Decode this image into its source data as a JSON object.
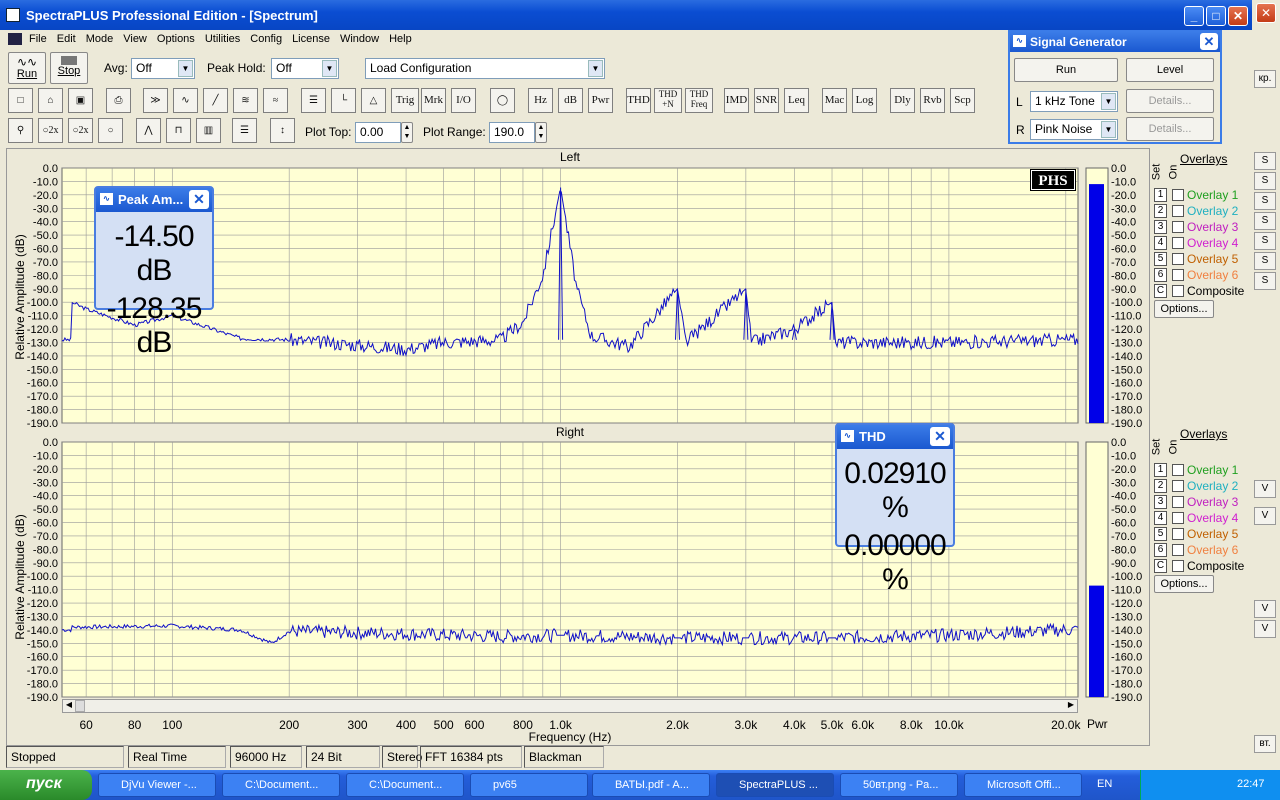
{
  "window": {
    "title": "SpectraPLUS Professional Edition - [Spectrum]"
  },
  "menu": [
    "File",
    "Edit",
    "Mode",
    "View",
    "Options",
    "Utilities",
    "Config",
    "License",
    "Window",
    "Help"
  ],
  "toolbar1": {
    "run": "Run",
    "stop": "Stop",
    "avg_label": "Avg:",
    "avg_value": "Off",
    "peakhold_label": "Peak Hold:",
    "peakhold_value": "Off",
    "config_value": "Load Configuration"
  },
  "toolbar2": [
    "Trig",
    "Mrk",
    "I/O",
    "Hz",
    "dB",
    "Pwr",
    "THD",
    "THD +N",
    "THD Freq",
    "IMD",
    "SNR",
    "Leq",
    "Mac",
    "Log",
    "Dly",
    "Rvb",
    "Scp"
  ],
  "toolbar3": {
    "plot_top_label": "Plot Top:",
    "plot_top_value": "0.00",
    "plot_range_label": "Plot Range:",
    "plot_range_value": "190.0"
  },
  "signal_generator": {
    "title": "Signal Generator",
    "run": "Run",
    "level": "Level",
    "l_label": "L",
    "l_value": "1 kHz Tone",
    "r_label": "R",
    "r_value": "Pink Noise",
    "details1": "Details...",
    "details2": "Details..."
  },
  "plots": {
    "left_title": "Left",
    "right_title": "Right",
    "ylabel": "Relative Amplitude (dB)",
    "xlabel": "Frequency (Hz)",
    "badge": "PHS",
    "pwr": "Pwr",
    "yticks": [
      "0.0",
      "-10.0",
      "-20.0",
      "-30.0",
      "-40.0",
      "-50.0",
      "-60.0",
      "-70.0",
      "-80.0",
      "-90.0",
      "-100.0",
      "-110.0",
      "-120.0",
      "-130.0",
      "-140.0",
      "-150.0",
      "-160.0",
      "-170.0",
      "-180.0",
      "-190.0"
    ],
    "xticks": [
      "60",
      "80",
      "100",
      "200",
      "300",
      "400",
      "500",
      "600",
      "800",
      "1.0k",
      "2.0k",
      "3.0k",
      "4.0k",
      "5.0k",
      "6.0k",
      "8.0k",
      "10.0k",
      "20.0k"
    ]
  },
  "overlays": {
    "header": "Overlays",
    "set": "Set",
    "on": "On",
    "items": [
      {
        "n": "1",
        "label": "Overlay 1",
        "color": "#1f9f1f"
      },
      {
        "n": "2",
        "label": "Overlay 2",
        "color": "#1fb0c0"
      },
      {
        "n": "3",
        "label": "Overlay 3",
        "color": "#c020c0"
      },
      {
        "n": "4",
        "label": "Overlay 4",
        "color": "#d020d0"
      },
      {
        "n": "5",
        "label": "Overlay 5",
        "color": "#c06000"
      },
      {
        "n": "6",
        "label": "Overlay 6",
        "color": "#f08040"
      },
      {
        "n": "C",
        "label": "Composite",
        "color": "#000000"
      }
    ],
    "options": "Options..."
  },
  "peak_popup": {
    "title": "Peak Am...",
    "v1": "-14.50 dB",
    "v2": "-128.35 dB"
  },
  "thd_popup": {
    "title": "THD",
    "v1": "0.02910 %",
    "v2": "0.00000 %"
  },
  "status": [
    "Stopped",
    "Real Time",
    "96000 Hz",
    "24 Bit",
    "Stereo",
    "FFT 16384 pts",
    "Blackman"
  ],
  "taskbar": {
    "start": "пуск",
    "items": [
      "DjVu Viewer -...",
      "C:\\Document...",
      "C:\\Document...",
      "pv65",
      "ВАТЫ.pdf - A...",
      "SpectraPLUS ...",
      "50вт.png - Pa...",
      "Microsoft Offi..."
    ],
    "lang": "EN",
    "clock": "22:47"
  },
  "meters": {
    "left_level_db": -2,
    "right_level_db": -109
  },
  "chart_data": [
    {
      "type": "line",
      "title": "Left",
      "xlabel": "Frequency (Hz)",
      "ylabel": "Relative Amplitude (dB)",
      "ylim": [
        -190,
        0
      ],
      "xscale": "log",
      "series": [
        {
          "values": [
            [
              55,
              -100
            ],
            [
              60,
              -105
            ],
            [
              80,
              -117
            ],
            [
              100,
              -110
            ],
            [
              150,
              -127
            ],
            [
              200,
              -128
            ],
            [
              300,
              -132
            ],
            [
              400,
              -135
            ],
            [
              500,
              -130
            ],
            [
              700,
              -128
            ],
            [
              800,
              -115
            ],
            [
              900,
              -80
            ],
            [
              1000,
              -14.5
            ],
            [
              1100,
              -90
            ],
            [
              1200,
              -125
            ],
            [
              1500,
              -133
            ],
            [
              2000,
              -90
            ],
            [
              2100,
              -130
            ],
            [
              3000,
              -90
            ],
            [
              3100,
              -130
            ],
            [
              4000,
              -120
            ],
            [
              5000,
              -100
            ],
            [
              5100,
              -130
            ],
            [
              8000,
              -130
            ],
            [
              10000,
              -130
            ],
            [
              20000,
              -128
            ]
          ]
        }
      ]
    },
    {
      "type": "line",
      "title": "Right",
      "xlabel": "Frequency (Hz)",
      "ylabel": "Relative Amplitude (dB)",
      "ylim": [
        -190,
        0
      ],
      "xscale": "log",
      "series": [
        {
          "values": [
            [
              55,
              -138
            ],
            [
              100,
              -137
            ],
            [
              150,
              -140
            ],
            [
              180,
              -150
            ],
            [
              200,
              -141
            ],
            [
              400,
              -143
            ],
            [
              700,
              -145
            ],
            [
              1000,
              -144
            ],
            [
              2000,
              -146
            ],
            [
              3000,
              -146
            ],
            [
              5000,
              -146
            ],
            [
              10000,
              -144
            ],
            [
              20000,
              -140
            ]
          ]
        }
      ]
    }
  ]
}
